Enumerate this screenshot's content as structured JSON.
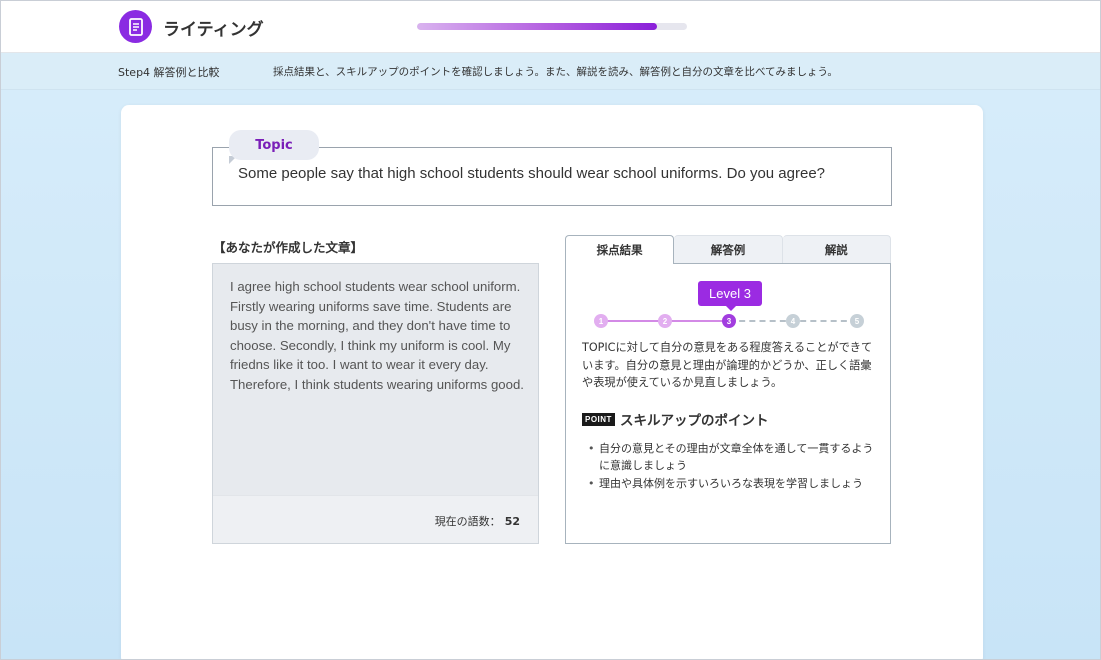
{
  "header": {
    "app_title": "ライティング",
    "progress_percent": 89
  },
  "stepbar": {
    "step_label": "Step4 解答例と比較",
    "description": "採点結果と、スキルアップのポイントを確認しましょう。また、解説を読み、解答例と自分の文章を比べてみましょう。"
  },
  "topic": {
    "tab_label": "Topic",
    "question": "Some people say that high school students should wear school uniforms. Do you agree?"
  },
  "essay": {
    "title": "【あなたが作成した文章】",
    "text": "I agree high school students wear school uniform. Firstly wearing uniforms save time. Students are busy in the morning, and they don't have time to choose. Secondly, I think my uniform is cool. My friedns like it too. I want to wear it every day. Therefore, I think students wearing uniforms good.",
    "wordcount_label": "現在の語数：",
    "wordcount_value": "52"
  },
  "result": {
    "tabs": [
      {
        "label": "採点結果",
        "active": true
      },
      {
        "label": "解答例",
        "active": false
      },
      {
        "label": "解説",
        "active": false
      }
    ],
    "level_label": "Level 3",
    "level": 3,
    "scale": [
      "1",
      "2",
      "3",
      "4",
      "5"
    ],
    "comment": "TOPICに対して自分の意見をある程度答えることができています。自分の意見と理由が論理的かどうか、正しく語彙や表現が使えているか見直しましょう。",
    "point_badge": "POINT",
    "point_title": "スキルアップのポイント",
    "points": [
      "自分の意見とその理由が文章全体を通して一貫するように意識しましょう",
      "理由や具体例を示すいろいろな表現を学習しましょう"
    ]
  },
  "colors": {
    "accent": "#8a2be2",
    "stepbar_bg": "#daedf8",
    "essay_bg": "#e7eaee"
  },
  "icons": {
    "app_icon": "document-icon"
  }
}
